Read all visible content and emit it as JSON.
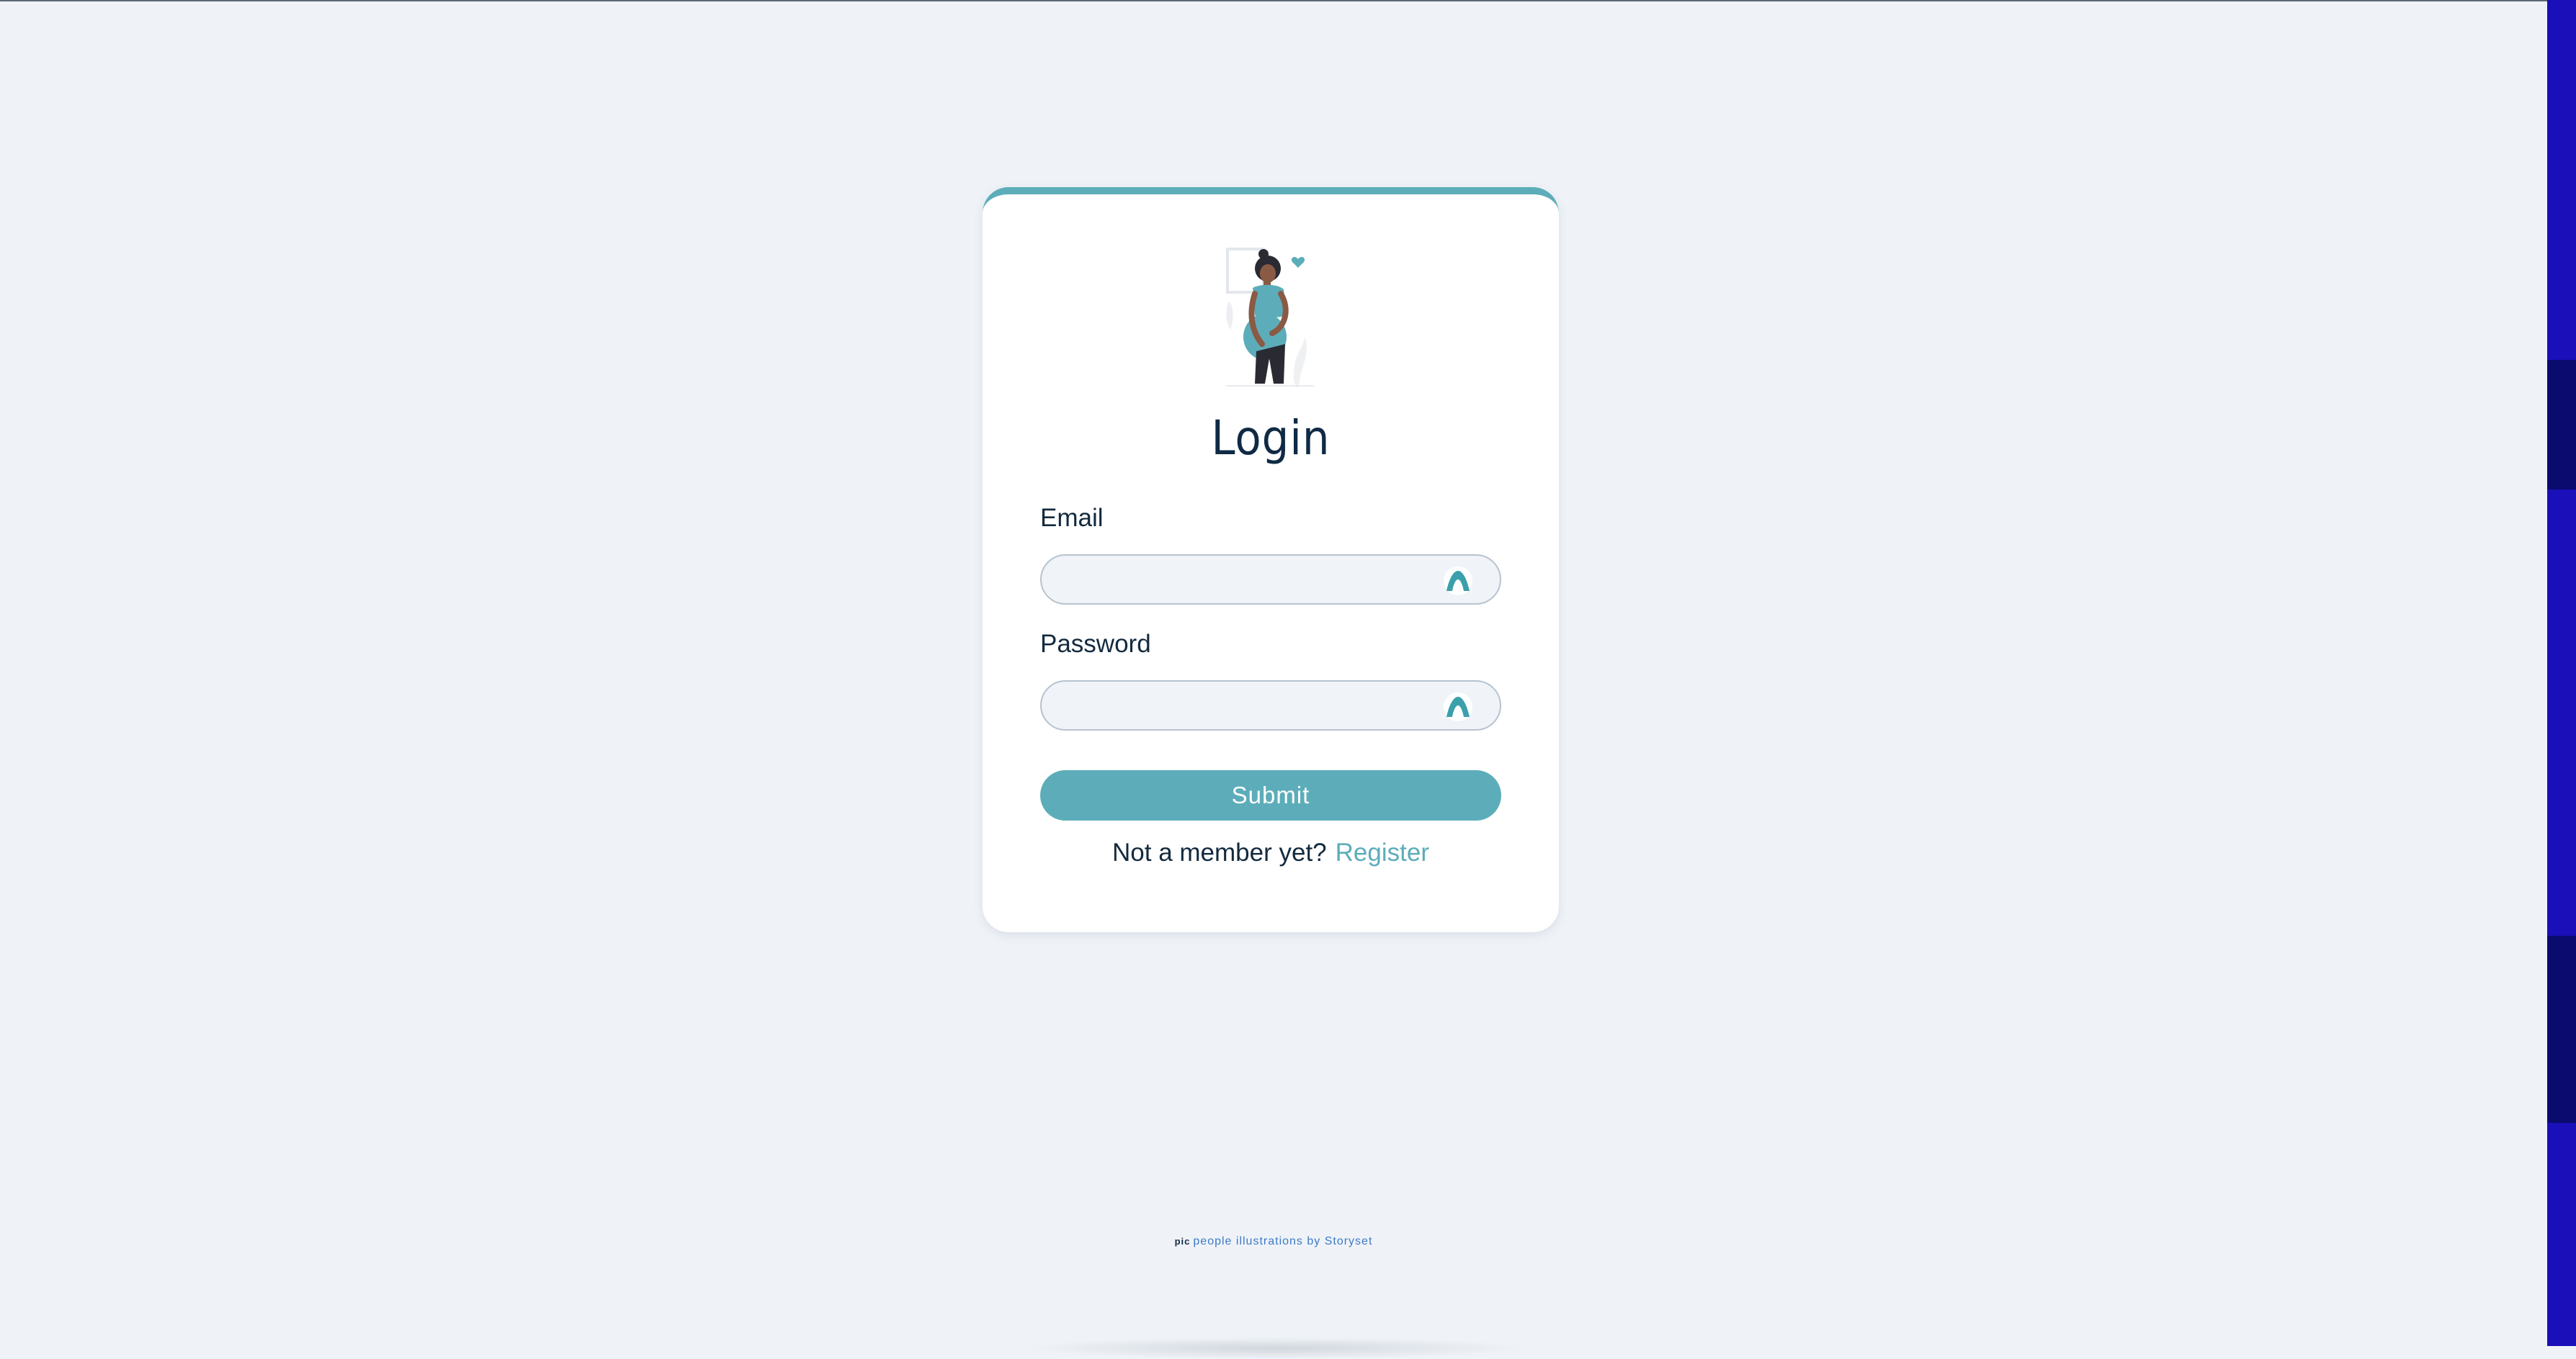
{
  "login": {
    "title": "Login",
    "email_label": "Email",
    "email_value": "",
    "password_label": "Password",
    "password_value": "",
    "submit_label": "Submit",
    "register_prompt": "Not a member yet?",
    "register_link": "Register"
  },
  "credit": {
    "pic": "pic",
    "text": "people illustrations by Storyset"
  },
  "colors": {
    "accent": "#5cadb9",
    "background": "#eff3f8",
    "card": "#ffffff",
    "text": "#132a3e"
  },
  "icons": {
    "illustration": "pregnant-woman-illustration",
    "field_icon": "autofill-key-icon"
  }
}
